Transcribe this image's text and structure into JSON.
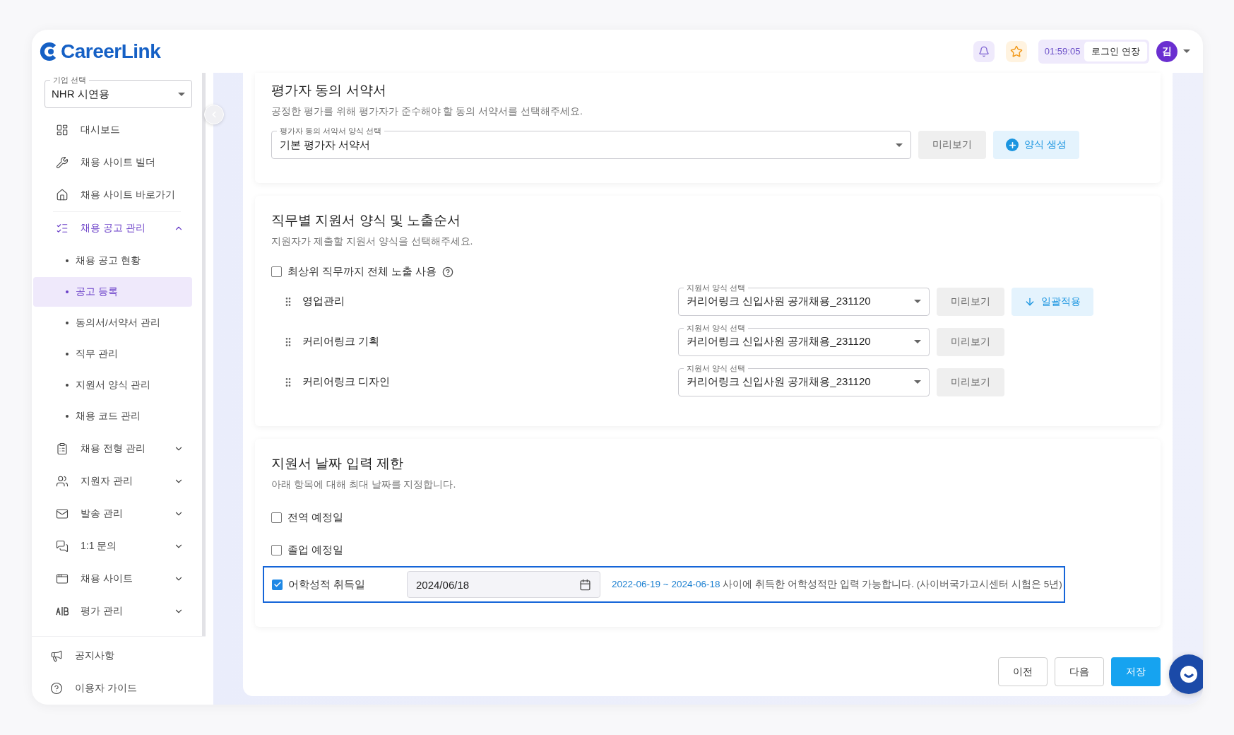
{
  "header": {
    "logo": "CareerLink",
    "timer": "01:59:05",
    "extend_button": "로그인 연장",
    "avatar": "김"
  },
  "sidebar": {
    "company_select": {
      "label": "기업 선택",
      "value": "NHR 시연용"
    },
    "items": [
      {
        "label": "대시보드"
      },
      {
        "label": "채용 사이트 빌더"
      },
      {
        "label": "채용 사이트 바로가기"
      },
      {
        "label": "채용 공고 관리",
        "expanded": true,
        "children": [
          {
            "label": "채용 공고 현황",
            "selected": false
          },
          {
            "label": "공고 등록",
            "selected": true
          },
          {
            "label": "동의서/서약서 관리",
            "selected": false
          },
          {
            "label": "직무 관리",
            "selected": false
          },
          {
            "label": "지원서 양식 관리",
            "selected": false
          },
          {
            "label": "채용 코드 관리",
            "selected": false
          }
        ]
      },
      {
        "label": "채용 전형 관리",
        "expanded": false
      },
      {
        "label": "지원자 관리",
        "expanded": false
      },
      {
        "label": "발송 관리",
        "expanded": false
      },
      {
        "label": "1:1 문의",
        "expanded": false
      },
      {
        "label": "채용 사이트",
        "expanded": false
      },
      {
        "label": "평가 관리",
        "expanded": false
      }
    ],
    "footer_items": [
      {
        "label": "공지사항"
      },
      {
        "label": "이용자 가이드"
      }
    ]
  },
  "consent_section": {
    "title": "평가자 동의 서약서",
    "description": "공정한 평가를 위해 평가자가 준수해야 할 동의 서약서를 선택해주세요.",
    "select": {
      "label": "평가자 동의 서약서 양식 선택",
      "value": "기본 평가자 서약서"
    },
    "preview_button": "미리보기",
    "create_button": "양식 생성"
  },
  "form_section": {
    "title": "직무별 지원서 양식 및 노출순서",
    "description": "지원자가 제출할 지원서 양식을 선택해주세요.",
    "option": {
      "label": "최상위 직무까지 전체 노출 사용",
      "checked": false
    },
    "jobs": [
      {
        "name": "영업관리",
        "select_label": "지원서 양식 선택",
        "value": "커리어링크 신입사원 공개채용_231120",
        "preview_button": "미리보기",
        "apply_all_button": "일괄적용"
      },
      {
        "name": "커리어링크 기획",
        "select_label": "지원서 양식 선택",
        "value": "커리어링크 신입사원 공개채용_231120",
        "preview_button": "미리보기"
      },
      {
        "name": "커리어링크 디자인",
        "select_label": "지원서 양식 선택",
        "value": "커리어링크 신입사원 공개채용_231120",
        "preview_button": "미리보기"
      }
    ]
  },
  "date_section": {
    "title": "지원서 날짜 입력 제한",
    "description": "아래 항목에 대해 최대 날짜를 지정합니다.",
    "items": [
      {
        "label": "전역 예정일",
        "checked": false
      },
      {
        "label": "졸업 예정일",
        "checked": false
      },
      {
        "label": "어학성적 취득일",
        "checked": true,
        "date": "2024/06/18",
        "range": "2022-06-19 ~ 2024-06-18",
        "note": "사이에 취득한 어학성적만 입력 가능합니다. (사이버국가고시센터 시험은 5년)"
      }
    ]
  },
  "footer_buttons": [
    {
      "label": "이전",
      "primary": false
    },
    {
      "label": "다음",
      "primary": false
    },
    {
      "label": "저장",
      "primary": true
    }
  ]
}
